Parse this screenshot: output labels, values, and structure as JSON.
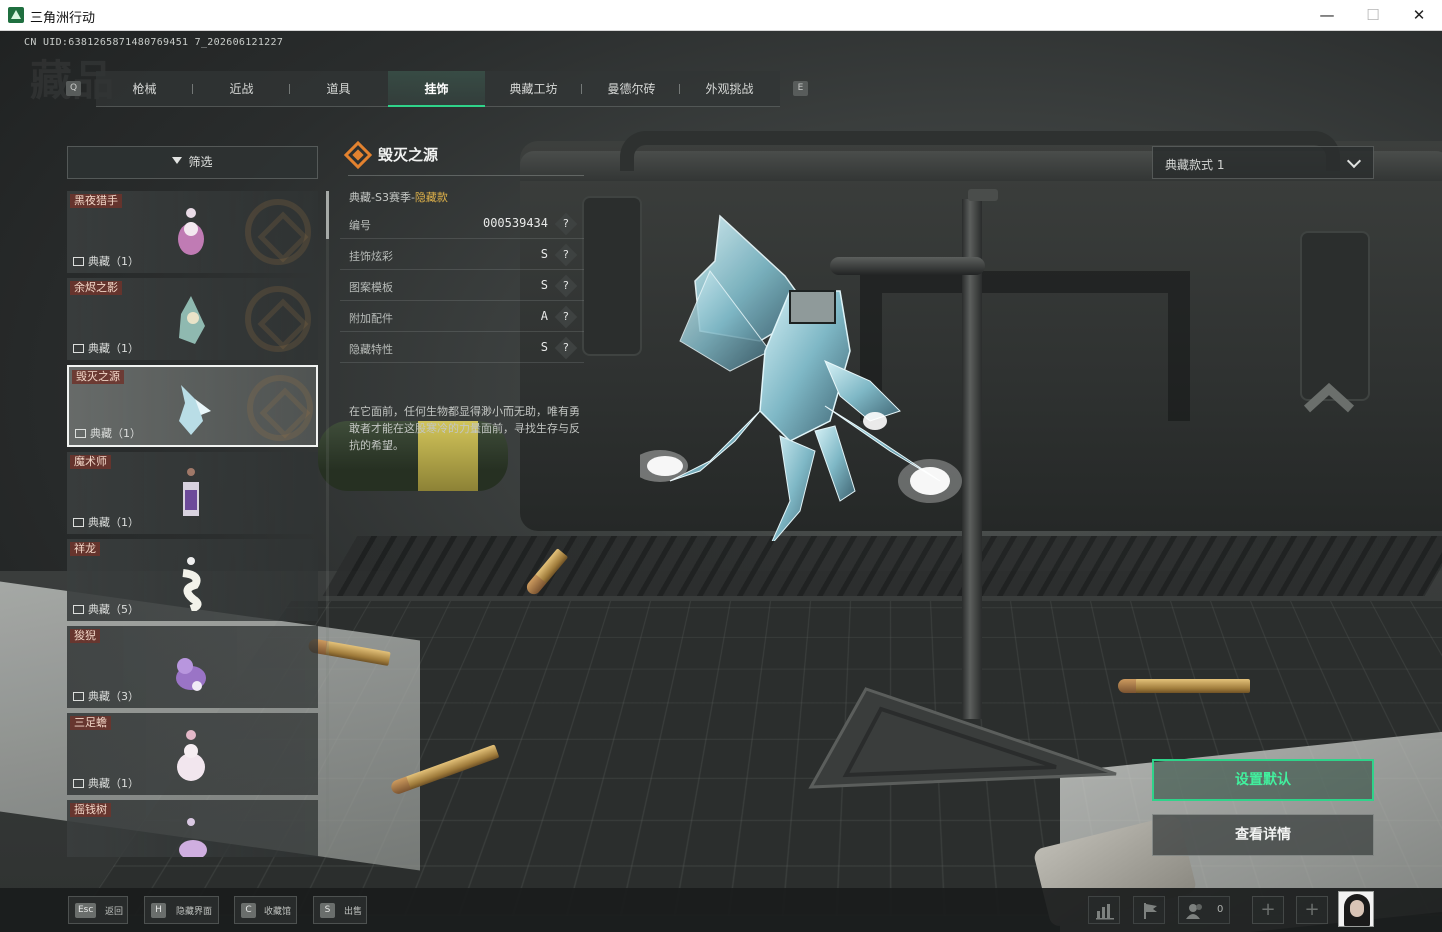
{
  "window": {
    "title": "三角洲行动",
    "minimize": "—",
    "maximize": "☐",
    "close": "✕"
  },
  "header": {
    "uid": "CN UID:6381265871480769451 7_202606121227",
    "bg_title": "藏品",
    "key_prev": "Q",
    "key_next": "E",
    "tabs": [
      {
        "label": "枪械",
        "active": false
      },
      {
        "label": "近战",
        "active": false
      },
      {
        "label": "道具",
        "active": false
      },
      {
        "label": "挂饰",
        "active": true
      },
      {
        "label": "典藏工坊",
        "active": false
      },
      {
        "label": "曼德尔砖",
        "active": false
      },
      {
        "label": "外观挑战",
        "active": false
      }
    ]
  },
  "filter": {
    "label": "筛选"
  },
  "list": [
    {
      "name": "黑夜猎手",
      "tier": "典藏（1）",
      "selected": false
    },
    {
      "name": "余烬之影",
      "tier": "典藏（1）",
      "selected": false
    },
    {
      "name": "毁灭之源",
      "tier": "典藏（1）",
      "selected": true
    },
    {
      "name": "魔术师",
      "tier": "典藏（1）",
      "selected": false
    },
    {
      "name": "祥龙",
      "tier": "典藏（5）",
      "selected": false
    },
    {
      "name": "狻猊",
      "tier": "典藏（3）",
      "selected": false
    },
    {
      "name": "三足蟾",
      "tier": "典藏（1）",
      "selected": false
    },
    {
      "name": "摇钱树",
      "tier": "",
      "selected": false
    }
  ],
  "detail": {
    "title": "毁灭之源",
    "subtitle_prefix": "典藏-S3赛季-",
    "subtitle_hidden": "隐藏款",
    "rows": [
      {
        "key": "编号",
        "value": "000539434"
      },
      {
        "key": "挂饰炫彩",
        "value": "S"
      },
      {
        "key": "图案模板",
        "value": "S"
      },
      {
        "key": "附加配件",
        "value": "A"
      },
      {
        "key": "隐藏特性",
        "value": "S"
      }
    ],
    "help": "?",
    "description": "在它面前，任何生物都显得渺小而无助，唯有勇敢者才能在这股寒冷的力量面前，寻找生存与反抗的希望。"
  },
  "style_select": {
    "value": "典藏款式 1"
  },
  "actions": {
    "set_default": "设置默认",
    "view_detail": "查看详情"
  },
  "bottom": {
    "hints": [
      {
        "key": "Esc",
        "label": "返回"
      },
      {
        "key": "H",
        "label": "隐藏界面"
      },
      {
        "key": "C",
        "label": "收藏馆"
      },
      {
        "key": "S",
        "label": "出售"
      }
    ],
    "friends_count": "0",
    "slot_plus": "+"
  },
  "colors": {
    "accent": "#2fd38a",
    "tag_bg": "#6e342c",
    "hidden_gold": "#e0b24a",
    "title_icon": "#e3822f"
  }
}
